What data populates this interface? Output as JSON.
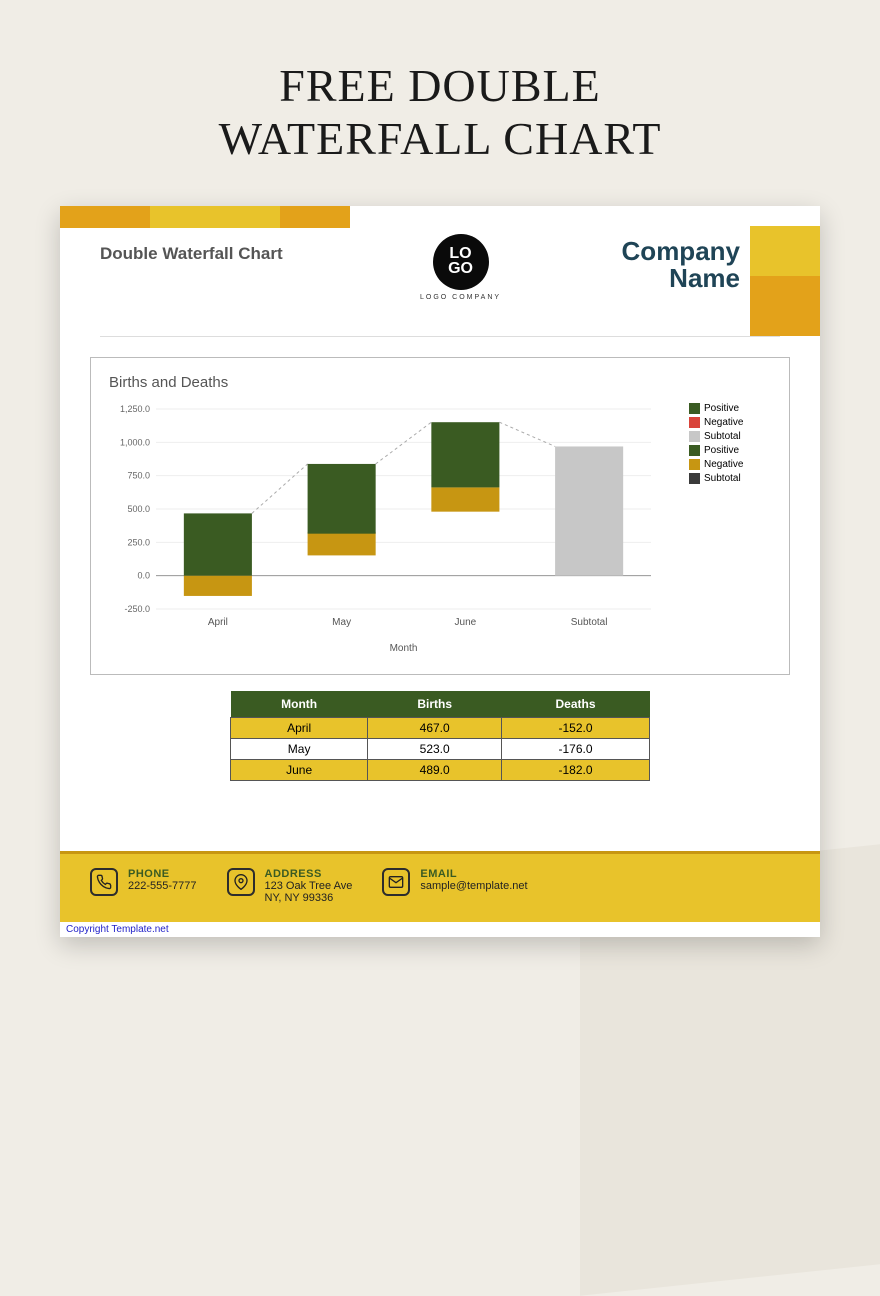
{
  "page_title_l1": "FREE DOUBLE",
  "page_title_l2": "WATERFALL CHART",
  "doc_title": "Double Waterfall Chart",
  "logo": {
    "text": "LO\nGO",
    "sub": "LOGO COMPANY"
  },
  "company_l1": "Company",
  "company_l2": "Name",
  "chart_title": "Births and Deaths",
  "xlabel": "Month",
  "legend": [
    {
      "label": "Positive",
      "color": "#3a5b22"
    },
    {
      "label": "Negative",
      "color": "#d9443a"
    },
    {
      "label": "Subtotal",
      "color": "#c7c7c7"
    },
    {
      "label": "Positive",
      "color": "#3a5b22"
    },
    {
      "label": "Negative",
      "color": "#c79612"
    },
    {
      "label": "Subtotal",
      "color": "#3a3a3a"
    }
  ],
  "table": {
    "headers": [
      "Month",
      "Births",
      "Deaths"
    ],
    "rows": [
      [
        "April",
        "467.0",
        "-152.0"
      ],
      [
        "May",
        "523.0",
        "-176.0"
      ],
      [
        "June",
        "489.0",
        "-182.0"
      ]
    ]
  },
  "footer": {
    "phone": {
      "label": "PHONE",
      "value": "222-555-7777"
    },
    "address": {
      "label": "ADDRESS",
      "l1": "123 Oak Tree Ave",
      "l2": "NY, NY 99336"
    },
    "email": {
      "label": "EMAIL",
      "value": "sample@template.net"
    }
  },
  "copyright": "Copyright Template.net",
  "chart_data": {
    "type": "bar",
    "title": "Births and Deaths",
    "xlabel": "Month",
    "ylabel": "",
    "ylim": [
      -250,
      1250
    ],
    "yticks": [
      -250,
      0,
      250,
      500,
      750,
      1000,
      1250
    ],
    "categories": [
      "April",
      "May",
      "June",
      "Subtotal"
    ],
    "series": [
      {
        "name": "Births",
        "values": [
          467.0,
          523.0,
          489.0,
          null
        ]
      },
      {
        "name": "Deaths",
        "values": [
          -152.0,
          -176.0,
          -182.0,
          null
        ]
      }
    ],
    "waterfall": [
      {
        "cat": "April",
        "birth_from": 0,
        "birth_to": 467,
        "death_from": -152,
        "death_to": 0
      },
      {
        "cat": "May",
        "birth_from": 315,
        "birth_to": 838,
        "death_from": 152,
        "death_to": 328
      },
      {
        "cat": "June",
        "birth_from": 662,
        "birth_to": 1151,
        "death_from": 480,
        "death_to": 662
      },
      {
        "cat": "Subtotal",
        "subtotal": 969
      }
    ]
  }
}
